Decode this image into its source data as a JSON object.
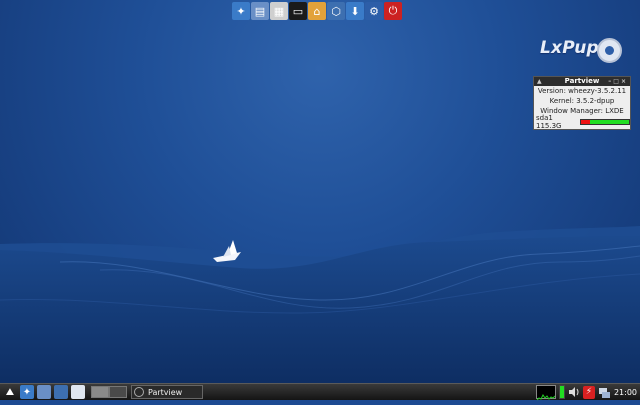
{
  "top_launcher": {
    "icons": [
      {
        "name": "control-panel-icon",
        "color": "#3a7bc8"
      },
      {
        "name": "folder-icon",
        "color": "#6a8fc6"
      },
      {
        "name": "file-cabinet-icon",
        "color": "#cfcfcf"
      },
      {
        "name": "terminal-icon",
        "color": "#1a1a1a"
      },
      {
        "name": "home-icon",
        "color": "#e2a23a"
      },
      {
        "name": "network-icon",
        "color": "#3d6fb0"
      },
      {
        "name": "package-manager-icon",
        "color": "#3a7bc8"
      },
      {
        "name": "settings-wheel-icon",
        "color": "#2d5ea8"
      },
      {
        "name": "power-icon",
        "color": "#cc2222"
      }
    ]
  },
  "logo": {
    "text": "LxPup"
  },
  "partview": {
    "title": "Partview",
    "version": "Version: wheezy-3.5.2.11",
    "kernel": "Kernel: 3.5.2-dpup",
    "wm": "Window Manager: LXDE",
    "disk_label": "sda1 115.3G",
    "disk_used_fraction": 0.18,
    "used_color": "#ee1111",
    "free_color": "#22dd22"
  },
  "taskbar": {
    "task_label": "Partview",
    "clock": "21:00"
  }
}
